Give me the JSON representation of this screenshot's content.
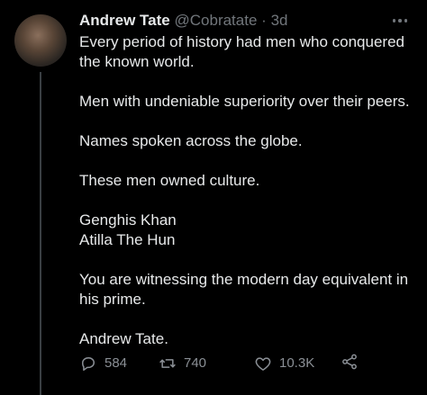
{
  "author": {
    "name": "Andrew Tate",
    "handle": "@Cobratate",
    "separator": "·",
    "time": "3d"
  },
  "tweet": {
    "paragraphs": [
      "Every period of history had men who conquered the known world.",
      "Men with undeniable superiority over their peers.",
      "Names spoken across the globe.",
      "These men owned culture.",
      "Genghis Khan\nAtilla The Hun",
      "You are witnessing the modern day equivalent in his prime.",
      "Andrew Tate."
    ]
  },
  "actions": {
    "replies": "584",
    "retweets": "740",
    "likes": "10.3K"
  },
  "colors": {
    "background": "#000000",
    "text": "#e7e9ea",
    "muted": "#71767b",
    "thread_line": "#3a3f43"
  },
  "icons": {
    "reply": "reply-icon",
    "retweet": "retweet-icon",
    "like": "heart-icon",
    "share": "share-icon",
    "more": "more-icon"
  }
}
